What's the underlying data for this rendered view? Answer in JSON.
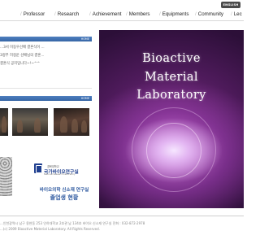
{
  "header": {
    "language_button": "ENGLISH",
    "nav": [
      {
        "label": "Professor"
      },
      {
        "label": "Research"
      },
      {
        "label": "Achievement"
      },
      {
        "label": "Members"
      },
      {
        "label": "Equipments"
      },
      {
        "label": "Community"
      },
      {
        "label": "Lec"
      }
    ]
  },
  "notice_panel": {
    "more_label": "HOME",
    "items": [
      {
        "text": "...3서 이동우선배 결혼식이 ..."
      },
      {
        "text": "3정부 허정운 선배님의 결혼..."
      },
      {
        "text": "결혼식 공지입니다~!~^^"
      }
    ]
  },
  "gallery_panel": {
    "more_label": "HOME"
  },
  "links": {
    "institute_logo": {
      "small_text": "경북대학교",
      "name": "국가바이오연구실",
      "sub_text": "National Research Laboratory"
    },
    "alumni": {
      "line1": "바이오의학 신소재 연구실",
      "line2": "졸업생 현황"
    }
  },
  "hero": {
    "title_lines": [
      "Bioactive",
      "Material",
      "Laboratory"
    ],
    "colors": {
      "deep": "#2c0f38",
      "mid": "#7b2f84",
      "glow": "#f6e6ff"
    }
  },
  "footer": {
    "address": "...인천광역시 남구 용현동 253 인하대학교 2호관 남 134호 바이오 신소재 연구실 전화 : 032-872-2978",
    "copyright": "...(c) 2009 Bioactive Material Laboratory. All Rights Reserved."
  },
  "colors": {
    "panel_header": "#3565a5",
    "accent_blue": "#2f5aa0",
    "text": "#222222"
  }
}
